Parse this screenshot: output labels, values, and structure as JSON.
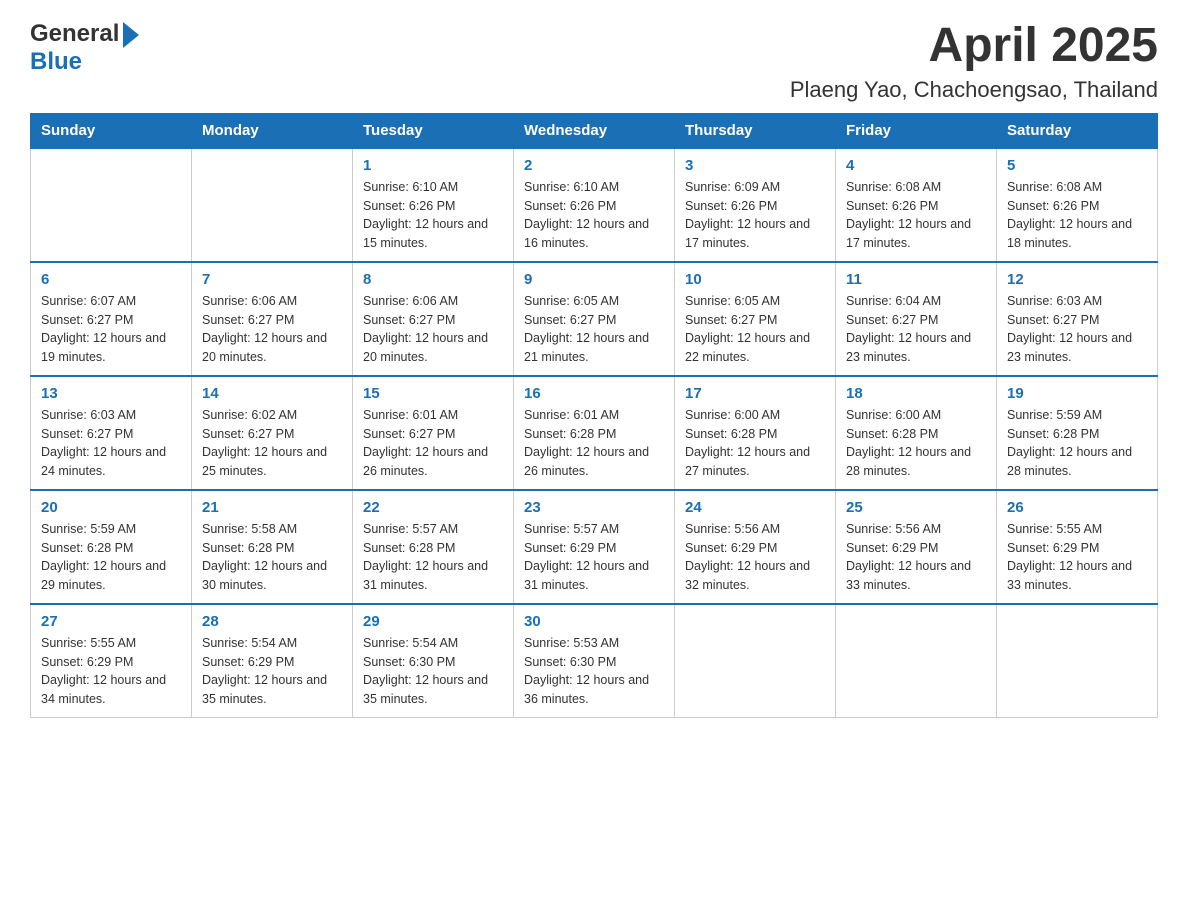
{
  "header": {
    "title": "April 2025",
    "subtitle": "Plaeng Yao, Chachoengsao, Thailand",
    "logo_line1": "General",
    "logo_line2": "Blue"
  },
  "days_of_week": [
    "Sunday",
    "Monday",
    "Tuesday",
    "Wednesday",
    "Thursday",
    "Friday",
    "Saturday"
  ],
  "weeks": [
    [
      {
        "day": "",
        "sunrise": "",
        "sunset": "",
        "daylight": ""
      },
      {
        "day": "",
        "sunrise": "",
        "sunset": "",
        "daylight": ""
      },
      {
        "day": "1",
        "sunrise": "Sunrise: 6:10 AM",
        "sunset": "Sunset: 6:26 PM",
        "daylight": "Daylight: 12 hours and 15 minutes."
      },
      {
        "day": "2",
        "sunrise": "Sunrise: 6:10 AM",
        "sunset": "Sunset: 6:26 PM",
        "daylight": "Daylight: 12 hours and 16 minutes."
      },
      {
        "day": "3",
        "sunrise": "Sunrise: 6:09 AM",
        "sunset": "Sunset: 6:26 PM",
        "daylight": "Daylight: 12 hours and 17 minutes."
      },
      {
        "day": "4",
        "sunrise": "Sunrise: 6:08 AM",
        "sunset": "Sunset: 6:26 PM",
        "daylight": "Daylight: 12 hours and 17 minutes."
      },
      {
        "day": "5",
        "sunrise": "Sunrise: 6:08 AM",
        "sunset": "Sunset: 6:26 PM",
        "daylight": "Daylight: 12 hours and 18 minutes."
      }
    ],
    [
      {
        "day": "6",
        "sunrise": "Sunrise: 6:07 AM",
        "sunset": "Sunset: 6:27 PM",
        "daylight": "Daylight: 12 hours and 19 minutes."
      },
      {
        "day": "7",
        "sunrise": "Sunrise: 6:06 AM",
        "sunset": "Sunset: 6:27 PM",
        "daylight": "Daylight: 12 hours and 20 minutes."
      },
      {
        "day": "8",
        "sunrise": "Sunrise: 6:06 AM",
        "sunset": "Sunset: 6:27 PM",
        "daylight": "Daylight: 12 hours and 20 minutes."
      },
      {
        "day": "9",
        "sunrise": "Sunrise: 6:05 AM",
        "sunset": "Sunset: 6:27 PM",
        "daylight": "Daylight: 12 hours and 21 minutes."
      },
      {
        "day": "10",
        "sunrise": "Sunrise: 6:05 AM",
        "sunset": "Sunset: 6:27 PM",
        "daylight": "Daylight: 12 hours and 22 minutes."
      },
      {
        "day": "11",
        "sunrise": "Sunrise: 6:04 AM",
        "sunset": "Sunset: 6:27 PM",
        "daylight": "Daylight: 12 hours and 23 minutes."
      },
      {
        "day": "12",
        "sunrise": "Sunrise: 6:03 AM",
        "sunset": "Sunset: 6:27 PM",
        "daylight": "Daylight: 12 hours and 23 minutes."
      }
    ],
    [
      {
        "day": "13",
        "sunrise": "Sunrise: 6:03 AM",
        "sunset": "Sunset: 6:27 PM",
        "daylight": "Daylight: 12 hours and 24 minutes."
      },
      {
        "day": "14",
        "sunrise": "Sunrise: 6:02 AM",
        "sunset": "Sunset: 6:27 PM",
        "daylight": "Daylight: 12 hours and 25 minutes."
      },
      {
        "day": "15",
        "sunrise": "Sunrise: 6:01 AM",
        "sunset": "Sunset: 6:27 PM",
        "daylight": "Daylight: 12 hours and 26 minutes."
      },
      {
        "day": "16",
        "sunrise": "Sunrise: 6:01 AM",
        "sunset": "Sunset: 6:28 PM",
        "daylight": "Daylight: 12 hours and 26 minutes."
      },
      {
        "day": "17",
        "sunrise": "Sunrise: 6:00 AM",
        "sunset": "Sunset: 6:28 PM",
        "daylight": "Daylight: 12 hours and 27 minutes."
      },
      {
        "day": "18",
        "sunrise": "Sunrise: 6:00 AM",
        "sunset": "Sunset: 6:28 PM",
        "daylight": "Daylight: 12 hours and 28 minutes."
      },
      {
        "day": "19",
        "sunrise": "Sunrise: 5:59 AM",
        "sunset": "Sunset: 6:28 PM",
        "daylight": "Daylight: 12 hours and 28 minutes."
      }
    ],
    [
      {
        "day": "20",
        "sunrise": "Sunrise: 5:59 AM",
        "sunset": "Sunset: 6:28 PM",
        "daylight": "Daylight: 12 hours and 29 minutes."
      },
      {
        "day": "21",
        "sunrise": "Sunrise: 5:58 AM",
        "sunset": "Sunset: 6:28 PM",
        "daylight": "Daylight: 12 hours and 30 minutes."
      },
      {
        "day": "22",
        "sunrise": "Sunrise: 5:57 AM",
        "sunset": "Sunset: 6:28 PM",
        "daylight": "Daylight: 12 hours and 31 minutes."
      },
      {
        "day": "23",
        "sunrise": "Sunrise: 5:57 AM",
        "sunset": "Sunset: 6:29 PM",
        "daylight": "Daylight: 12 hours and 31 minutes."
      },
      {
        "day": "24",
        "sunrise": "Sunrise: 5:56 AM",
        "sunset": "Sunset: 6:29 PM",
        "daylight": "Daylight: 12 hours and 32 minutes."
      },
      {
        "day": "25",
        "sunrise": "Sunrise: 5:56 AM",
        "sunset": "Sunset: 6:29 PM",
        "daylight": "Daylight: 12 hours and 33 minutes."
      },
      {
        "day": "26",
        "sunrise": "Sunrise: 5:55 AM",
        "sunset": "Sunset: 6:29 PM",
        "daylight": "Daylight: 12 hours and 33 minutes."
      }
    ],
    [
      {
        "day": "27",
        "sunrise": "Sunrise: 5:55 AM",
        "sunset": "Sunset: 6:29 PM",
        "daylight": "Daylight: 12 hours and 34 minutes."
      },
      {
        "day": "28",
        "sunrise": "Sunrise: 5:54 AM",
        "sunset": "Sunset: 6:29 PM",
        "daylight": "Daylight: 12 hours and 35 minutes."
      },
      {
        "day": "29",
        "sunrise": "Sunrise: 5:54 AM",
        "sunset": "Sunset: 6:30 PM",
        "daylight": "Daylight: 12 hours and 35 minutes."
      },
      {
        "day": "30",
        "sunrise": "Sunrise: 5:53 AM",
        "sunset": "Sunset: 6:30 PM",
        "daylight": "Daylight: 12 hours and 36 minutes."
      },
      {
        "day": "",
        "sunrise": "",
        "sunset": "",
        "daylight": ""
      },
      {
        "day": "",
        "sunrise": "",
        "sunset": "",
        "daylight": ""
      },
      {
        "day": "",
        "sunrise": "",
        "sunset": "",
        "daylight": ""
      }
    ]
  ]
}
